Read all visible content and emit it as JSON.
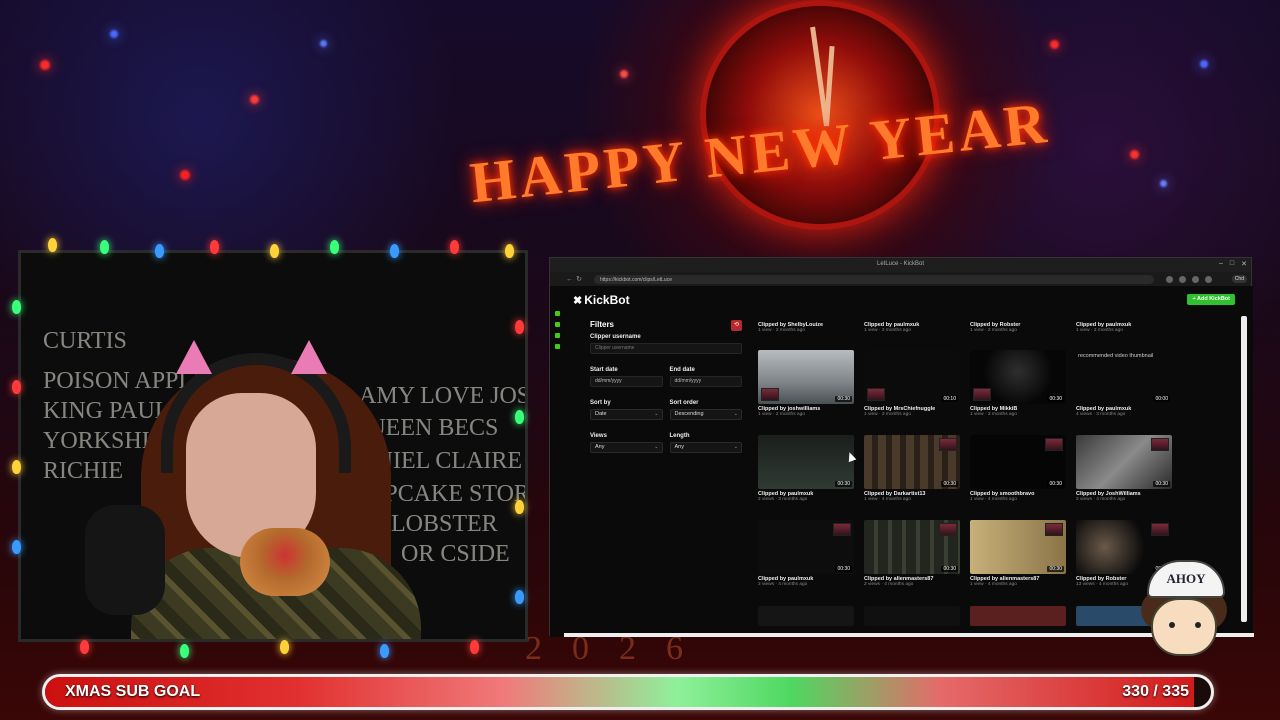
{
  "overlay": {
    "headline": "HAPPY NEW YEAR",
    "floor_year": "2026",
    "chalkboard_names": [
      "CURTIS",
      "POISON APPLE",
      "KING PAUL",
      "YORKSHI",
      "RICHIE",
      "DR AMY LOVE JOSH",
      "QUEEN BECS",
      "DANIEL CLAIRE",
      "CUPCAKE STORM",
      "LOBSTER",
      "OR CSIDE"
    ],
    "mascot_hat": "AHOY",
    "sub_goal": {
      "label": "XMAS SUB GOAL",
      "count": "330 / 335",
      "progress": 0.985
    }
  },
  "browser": {
    "window_title": "LetLuce - KickBot",
    "url": "https://kickbot.com/clips/LetLuce",
    "profile_chip": "Chd",
    "app": {
      "logo": "KickBot",
      "add_button": "+ Add KickBot",
      "filters": {
        "title": "Filters",
        "clipper_username_label": "Clipper username",
        "clipper_username_placeholder": "Clipper username",
        "start_date_label": "Start date",
        "start_date_placeholder": "dd/mm/yyyy",
        "end_date_label": "End date",
        "end_date_placeholder": "dd/mm/yyyy",
        "sort_by_label": "Sort by",
        "sort_by_value": "Date",
        "sort_order_label": "Sort order",
        "sort_order_value": "Descending",
        "views_label": "Views",
        "views_value": "Any",
        "length_label": "Length",
        "length_value": "Any"
      },
      "clips": [
        {
          "author": "Clipped by ShelbyLouize",
          "meta": "1 view · 2 months ago",
          "duration": ""
        },
        {
          "author": "Clipped by paulmxuk",
          "meta": "1 view · 2 months ago",
          "duration": ""
        },
        {
          "author": "Clipped by Robster",
          "meta": "1 view · 2 months ago",
          "duration": ""
        },
        {
          "author": "Clipped by paulmxuk",
          "meta": "1 view · 2 months ago",
          "duration": ""
        },
        {
          "author": "Clipped by joshwilliams",
          "meta": "1 view · 2 months ago",
          "duration": "00:30"
        },
        {
          "author": "Clipped by MrsChiefnuggle",
          "meta": "1 view · 3 months ago",
          "duration": "00:10"
        },
        {
          "author": "Clipped by MikkiB",
          "meta": "1 view · 3 months ago",
          "duration": "00:30"
        },
        {
          "author": "Clipped by paulmxuk",
          "meta": "4 views · 3 months ago",
          "duration": "00:00",
          "alt": "recommended video thumbnail"
        },
        {
          "author": "Clipped by paulmxuk",
          "meta": "2 views · 3 months ago",
          "duration": "00:30"
        },
        {
          "author": "Clipped by Darkartist13",
          "meta": "1 view · 4 months ago",
          "duration": "00:30"
        },
        {
          "author": "Clipped by smoothbravo",
          "meta": "1 view · 4 months ago",
          "duration": "00:30"
        },
        {
          "author": "Clipped by JoshWilliams",
          "meta": "2 views · 4 months ago",
          "duration": "00:30"
        },
        {
          "author": "Clipped by paulmxuk",
          "meta": "2 views · 4 months ago",
          "duration": "00:30"
        },
        {
          "author": "Clipped by alienmasters87",
          "meta": "2 views · 4 months ago",
          "duration": "00:30"
        },
        {
          "author": "Clipped by alienmasters87",
          "meta": "1 view · 4 months ago",
          "duration": "00:30"
        },
        {
          "author": "Clipped by Robster",
          "meta": "13 views · 4 months ago",
          "duration": "00:30"
        }
      ]
    }
  }
}
